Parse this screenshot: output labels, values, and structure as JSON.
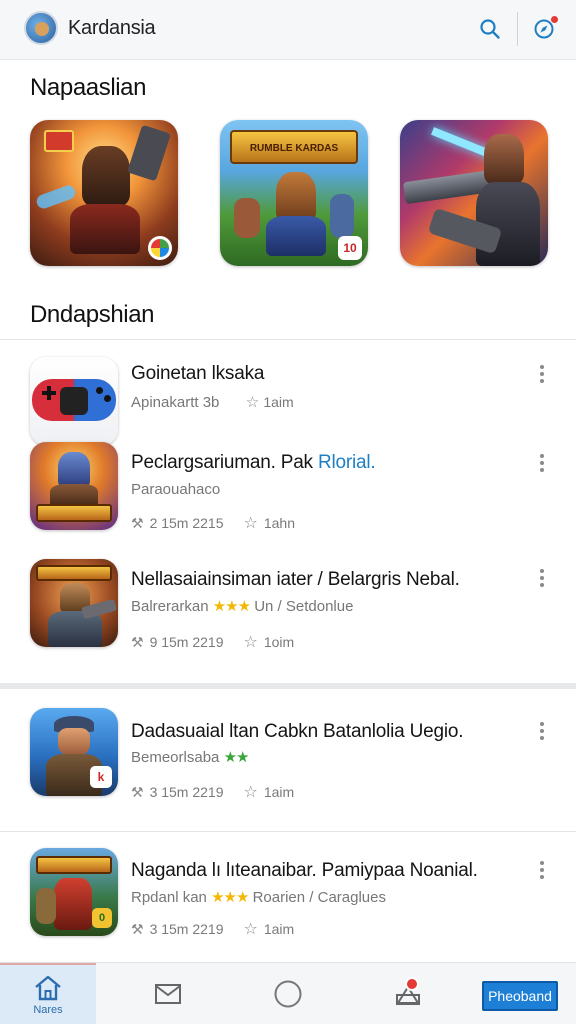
{
  "header": {
    "title": "Kardansia",
    "icons": [
      "search-icon",
      "compass-icon"
    ],
    "accent": "#1e7fc4"
  },
  "featured": {
    "title": "Napaaslian",
    "tiles": [
      {
        "name": "featured-tile-1",
        "banner": "",
        "badge": ""
      },
      {
        "name": "featured-tile-2",
        "banner": "RUMBLE KARDAS",
        "badge": "10"
      },
      {
        "name": "featured-tile-3",
        "banner": "",
        "badge": ""
      }
    ]
  },
  "list_section": {
    "title": "Dndapshian"
  },
  "items": [
    {
      "title": "Goinetan lksaka",
      "title_accent": "",
      "sub": "Apinakartt 3b",
      "stars": "",
      "sub_after": "",
      "rating": "1aim",
      "meta": ""
    },
    {
      "title": "Peclargsariuman. Pak ",
      "title_accent": "Rlorial.",
      "sub": "Paraouahaco",
      "stars": "",
      "sub_after": "",
      "rating": "1ahn",
      "meta": "2 15m 2215"
    },
    {
      "title": "Nellasaiainsiman iater / Belargris Nebal.",
      "title_accent": "",
      "sub": "Balrerarkan ",
      "stars": "★★★",
      "sub_after": " Un / Setdonlue",
      "rating": "1oim",
      "meta": "9 15m 2219"
    },
    {
      "title": "Dadasuaial ltan Cabkn Batanlolia Uegio.",
      "title_accent": "",
      "sub": "Bemeorlsaba ",
      "stars": "★★",
      "sub_after": "",
      "rating": "1aim",
      "meta": "3 15m 2219"
    },
    {
      "title": "Naganda lı lıteanaibar. Pamiypaa Noanial.",
      "title_accent": "",
      "sub": "Rpdanl kan ",
      "stars": "★★★",
      "sub_after": " Roarien / Caraglues",
      "rating": "1aim",
      "meta": "3 15m 2219"
    }
  ],
  "bottom_nav": {
    "home_label": "Nares",
    "button_label": "Pheoband",
    "icons": [
      "home-icon",
      "mail-icon",
      "circle-icon",
      "notification-icon"
    ]
  }
}
